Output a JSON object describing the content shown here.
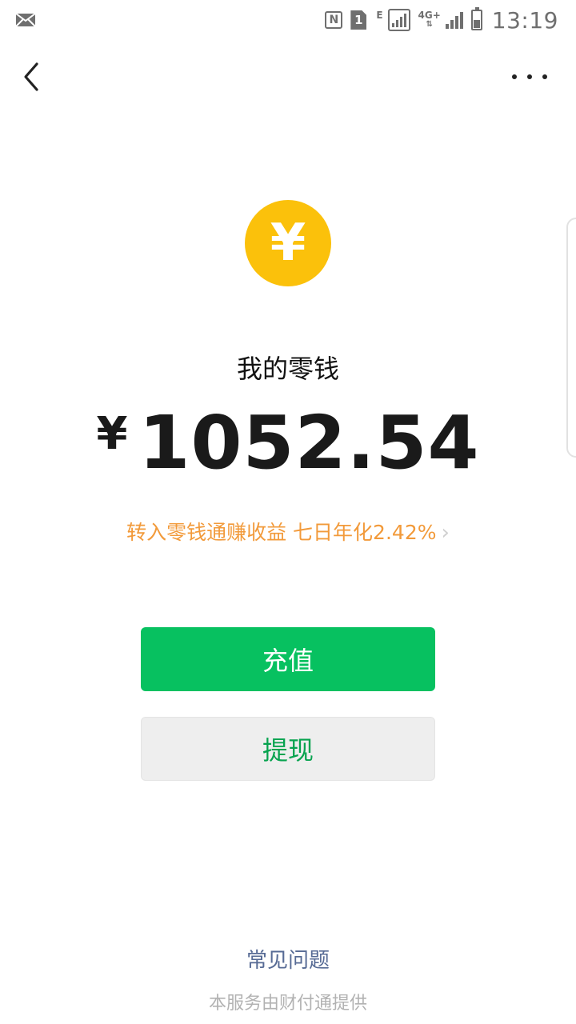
{
  "status_bar": {
    "time": "13:19",
    "nfc": "N",
    "sim": "1",
    "network_e": "E",
    "network_4g": "4G+"
  },
  "icons": {
    "back": "chevron-left-icon",
    "more": "more-dots-icon",
    "coin": "yuan-coin-icon"
  },
  "coin_symbol": "¥",
  "wallet": {
    "title": "我的零钱",
    "currency": "¥",
    "amount": "1052.54"
  },
  "promo": {
    "text": "转入零钱通赚收益 七日年化2.42%",
    "arrow": "›"
  },
  "buttons": {
    "topup": "充值",
    "withdraw": "提现"
  },
  "footer": {
    "faq": "常见问题",
    "provider": "本服务由财付通提供"
  },
  "colors": {
    "primary_green": "#07c160",
    "coin_yellow": "#fbc10b",
    "promo_orange": "#f29a3a",
    "link_blue": "#576b95"
  }
}
